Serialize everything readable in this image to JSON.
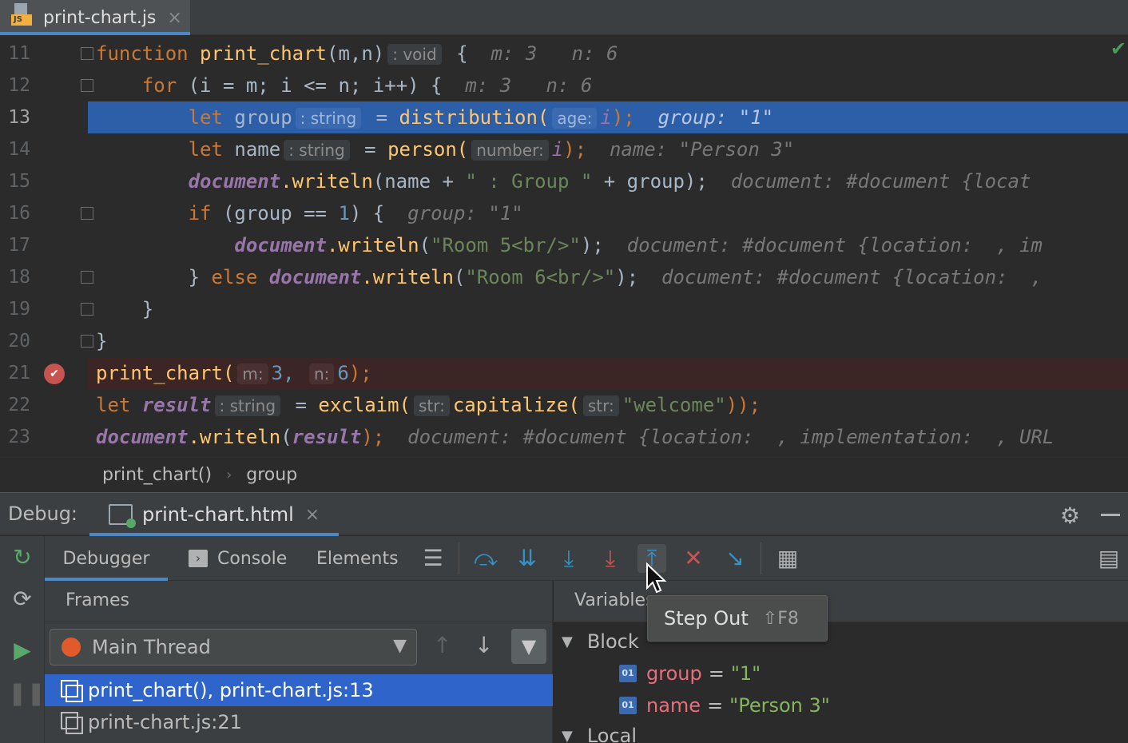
{
  "tabbar": {
    "file_tab": {
      "badge": "JS",
      "name": "print-chart.js",
      "close": "×"
    }
  },
  "editor": {
    "lines": [
      {
        "n": "11"
      },
      {
        "n": "12"
      },
      {
        "n": "13"
      },
      {
        "n": "14"
      },
      {
        "n": "15"
      },
      {
        "n": "16"
      },
      {
        "n": "17"
      },
      {
        "n": "18"
      },
      {
        "n": "19"
      },
      {
        "n": "20"
      },
      {
        "n": "21"
      },
      {
        "n": "22"
      },
      {
        "n": "23"
      }
    ],
    "code": {
      "l11": {
        "kw": "function",
        "fn": "print_chart",
        "params": "(m,n)",
        "hint": ": void",
        "brace": "{",
        "inline": "m: 3   n: 6"
      },
      "l12": {
        "kw": "for",
        "head": "(i = m; i <= n; i++) {",
        "inline": "m: 3   n: 6"
      },
      "l13": {
        "kw": "let",
        "name": "group",
        "hint": ": string",
        "eq": "=",
        "fn": "distribution(",
        "hint2": "age:",
        "arg": "i",
        "end": ");",
        "inline": "group: \"1\""
      },
      "l14": {
        "kw": "let",
        "name": "name",
        "hint": ": string",
        "eq": "=",
        "fn": "person(",
        "hint2": "number:",
        "arg": "i",
        "end": ");",
        "inline": "name: \"Person 3\""
      },
      "l15": {
        "glob": "document",
        "fn": ".writeln",
        "open": "(name + ",
        "str": "\" : Group \"",
        "rest": " + group);",
        "inline": "document: #document {locat"
      },
      "l16": {
        "kw": "if",
        "cond": "(group == ",
        "num": "1",
        "rest": ") {",
        "inline": "group: \"1\""
      },
      "l17": {
        "glob": "document",
        "fn": ".writeln",
        "open": "(",
        "str": "\"Room 5<br/>\"",
        "rest": ");",
        "inline": "document: #document {location:  , im"
      },
      "l18": {
        "pre": "} ",
        "kw": "else",
        "glob": "document",
        "fn": ".writeln",
        "open": "(",
        "str": "\"Room 6<br/>\"",
        "rest": ");",
        "inline": "document: #document {location:  ,"
      },
      "l19": {
        "text": "}"
      },
      "l20": {
        "text": "}"
      },
      "l21": {
        "fn": "print_chart(",
        "hint1": "m:",
        "a1": "3,",
        "hint2": "n:",
        "a2": "6",
        "end": ");"
      },
      "l22": {
        "kw": "let",
        "var": "result",
        "hint": ": string",
        "eq": "=",
        "fn": "exclaim(",
        "hint2": "str:",
        "fn2": "capitalize(",
        "hint3": "str:",
        "str": "\"welcome\"",
        "end": "));"
      },
      "l23": {
        "glob": "document",
        "fn": ".writeln",
        "open": "(",
        "var": "result",
        "rest": ");",
        "inline": "document: #document {location:  , implementation:  , URL"
      }
    }
  },
  "breadcrumb": {
    "items": [
      "print_chart()",
      "group"
    ],
    "sep": "›"
  },
  "debug": {
    "title": "Debug:",
    "session_tab": {
      "label": "print-chart.html",
      "close": "×"
    },
    "sub_tabs": {
      "debugger": "Debugger",
      "console": "Console",
      "elements": "Elements"
    },
    "frames": {
      "title": "Frames",
      "thread": "Main Thread",
      "rows": [
        "print_chart(), print-chart.js:13",
        "print-chart.js:21"
      ]
    },
    "variables": {
      "title": "Variables",
      "groups": {
        "block": "Block",
        "local": "Local"
      },
      "items": [
        {
          "icon": "01",
          "name": "group",
          "eq": "=",
          "value": "\"1\""
        },
        {
          "icon": "01",
          "name": "name",
          "eq": "=",
          "value": "\"Person 3\""
        }
      ]
    },
    "tooltip": {
      "label": "Step Out",
      "shortcut": "⇧F8"
    }
  }
}
